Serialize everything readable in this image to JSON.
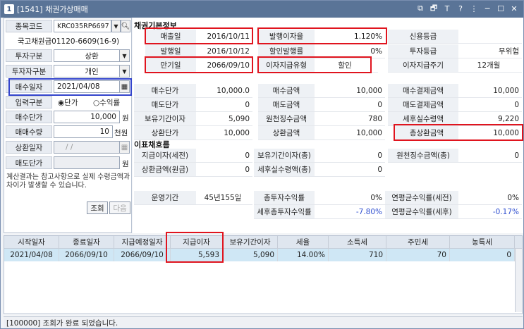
{
  "window": {
    "title": "[1541] 채권가상매매",
    "app_icon": "1"
  },
  "titlebar_icons": {
    "i1": "⧉",
    "i2": "🗗",
    "i3": "Ｔ",
    "i4": "?",
    "i5": "⋮",
    "i6": "─",
    "i7": "☐",
    "i8": "✕"
  },
  "left": {
    "stock_code_label": "종목코드",
    "stock_code": "KRC035RP6697",
    "bond_name": "국고채원금01120-6609(16-9)",
    "invest_type_label": "투자구분",
    "invest_type": "상환",
    "investor_type_label": "투자자구분",
    "investor_type": "개인",
    "buy_date_label": "매수일자",
    "buy_date": "2021/04/08",
    "input_type_label": "입력구분",
    "radio_unit": "◉단가",
    "radio_yield": "○수익률",
    "buy_price_label": "매수단가",
    "buy_price": "10,000",
    "buy_price_unit": "원",
    "qty_label": "매매수량",
    "qty": "10",
    "qty_unit": "천원",
    "redeem_date_label": "상환일자",
    "redeem_date": "/    /",
    "sell_price_label": "매도단가",
    "sell_price_unit": "원",
    "note": "계산결과는 참고사항으로 실제 수령금액과 차이가 발생할 수 있습니다.",
    "query_btn": "조회",
    "next_btn": "다음"
  },
  "basic": {
    "title": "채권기본정보",
    "issue_date_label": "매출일",
    "issue_date": "2016/10/11",
    "coupon_label": "발행이자율",
    "coupon": "1.120%",
    "credit_label": "신용등급",
    "credit": "",
    "publish_label": "발행일",
    "publish": "2016/10/12",
    "discount_label": "할인발행률",
    "discount": "0%",
    "grade_label": "투자등급",
    "grade": "무위험",
    "maturity_label": "만기일",
    "maturity": "2066/09/10",
    "pay_type_label": "이자지급유형",
    "pay_type": "할인",
    "pay_cycle_label": "이자지급주기",
    "pay_cycle": "12개월"
  },
  "amounts": {
    "r1": [
      "매수단가",
      "10,000.0",
      "매수금액",
      "10,000",
      "매수결제금액",
      "10,000"
    ],
    "r2": [
      "매도단가",
      "0",
      "매도금액",
      "0",
      "매도결제금액",
      "0"
    ],
    "r3": [
      "보유기간이자",
      "5,090",
      "원천징수금액",
      "780",
      "세후실수령액",
      "9,220"
    ],
    "r4": [
      "상환단가",
      "10,000",
      "상환금액",
      "10,000",
      "총상환금액",
      "10,000"
    ]
  },
  "cashflow": {
    "title": "이표채흐름",
    "r1": [
      "지급이자(세전)",
      "0",
      "보유기간이자(총)",
      "0",
      "원천징수금액(총)",
      "0"
    ],
    "r2": [
      "상환금액(원금)",
      "0",
      "세후실수령액(총)",
      "0"
    ],
    "period_label": "운영기간",
    "period": "45년155일",
    "total_yield_label": "총투자수익률",
    "total_yield": "0%",
    "annual_label": "연평균수익률(세전)",
    "annual": "0%",
    "after_total_label": "세후총투자수익률",
    "after_total": "-7.80%",
    "after_annual_label": "연평균수익률(세후)",
    "after_annual": "-0.17%"
  },
  "grid": {
    "headers": [
      "시작일자",
      "종료일자",
      "지급예정일자",
      "지급이자",
      "보유기간이자",
      "세율",
      "소득세",
      "주민세",
      "농특세"
    ],
    "rows": [
      [
        "2021/04/08",
        "2066/09/10",
        "2066/09/10",
        "5,593",
        "5,090",
        "14.00%",
        "710",
        "70",
        "0"
      ]
    ]
  },
  "status": "[100000] 조회가 완료 되었습니다."
}
